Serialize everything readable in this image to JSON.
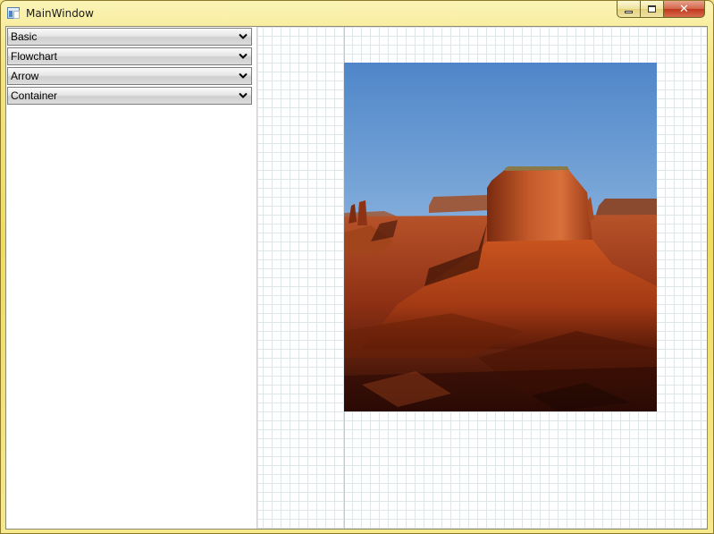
{
  "window": {
    "title": "MainWindow",
    "icon": "app-window-icon",
    "caption_buttons": {
      "minimize": "minimize",
      "maximize": "maximize",
      "close": "✕"
    }
  },
  "sidebar": {
    "panels": [
      {
        "label": "Basic",
        "icon": "chevron-down-icon"
      },
      {
        "label": "Flowchart",
        "icon": "chevron-down-icon"
      },
      {
        "label": "Arrow",
        "icon": "chevron-down-icon"
      },
      {
        "label": "Container",
        "icon": "chevron-down-icon"
      }
    ]
  },
  "canvas": {
    "grid": true,
    "image": {
      "subject": "desert-butte-photo"
    }
  },
  "colors": {
    "frame": "#f0dc5e",
    "grid_line": "#dfe6ea",
    "guide_line": "#a9d2ee",
    "sky_top": "#4f86c9",
    "rock": "#b3411b"
  }
}
